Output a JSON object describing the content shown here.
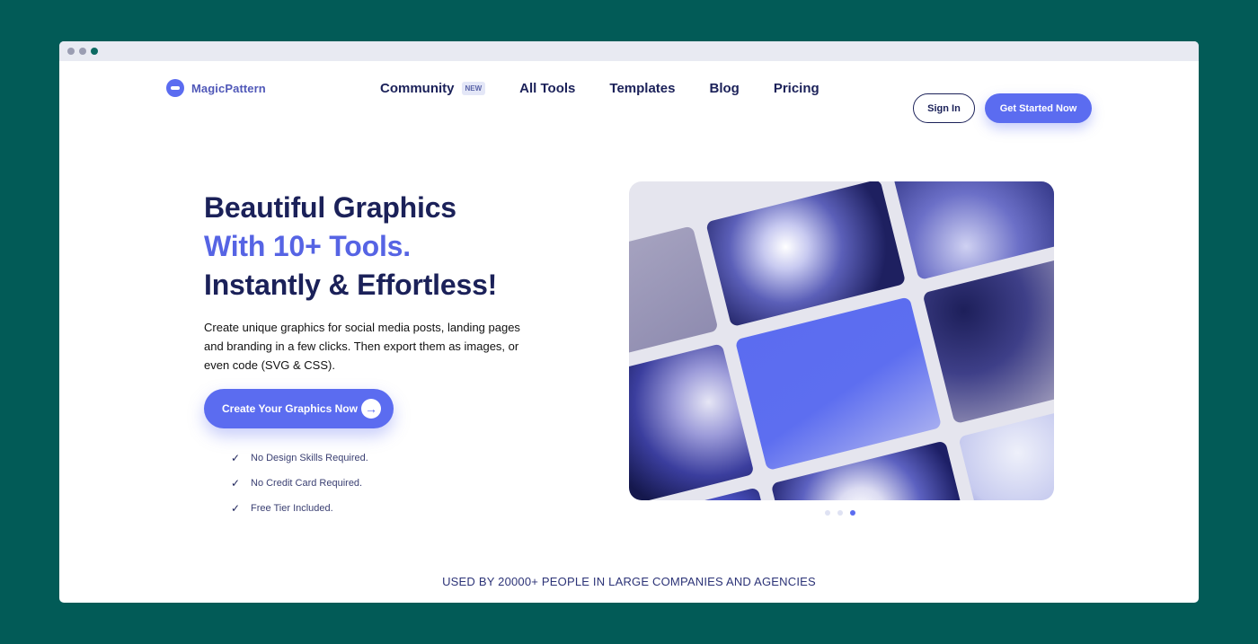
{
  "brand": {
    "name": "MagicPattern"
  },
  "nav": {
    "items": [
      {
        "label": "Community",
        "badge": "NEW"
      },
      {
        "label": "All Tools"
      },
      {
        "label": "Templates"
      },
      {
        "label": "Blog"
      },
      {
        "label": "Pricing"
      }
    ],
    "sign_in": "Sign In",
    "get_started": "Get Started Now"
  },
  "hero": {
    "title_line1": "Beautiful Graphics",
    "title_line2": "With 10+ Tools.",
    "title_line3": "Instantly & Effortless!",
    "description": "Create unique graphics for social media posts, landing pages and branding in a few clicks. Then export them as images, or even code (SVG & CSS).",
    "cta": "Create Your Graphics Now",
    "checks": [
      "No Design Skills Required.",
      "No Credit Card Required.",
      "Free Tier Included."
    ]
  },
  "carousel": {
    "active_index": 2,
    "count": 3
  },
  "social_proof": {
    "text": "USED BY 20000+ PEOPLE IN LARGE COMPANIES AND AGENCIES"
  },
  "colors": {
    "background": "#025b57",
    "accent": "#5b6cf0",
    "navy": "#1b2159",
    "accent_text": "#5664e4"
  }
}
